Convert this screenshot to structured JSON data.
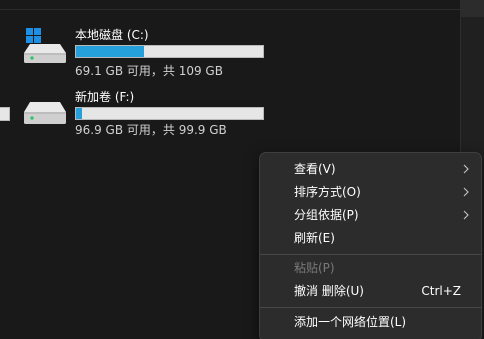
{
  "drives": [
    {
      "name": "本地磁盘 (C:)",
      "info": "69.1 GB 可用，共 109 GB",
      "used_fraction": 0.366,
      "icon": "windows-drive-icon"
    },
    {
      "name": "新加卷 (F:)",
      "info": "96.9 GB 可用，共 99.9 GB",
      "used_fraction": 0.03,
      "icon": "hard-drive-icon"
    }
  ],
  "colors": {
    "background": "#191919",
    "bar_fill": "#26a0da",
    "bar_track": "#e6e6e6",
    "menu_bg": "#2c2c2c",
    "menu_disabled_text": "#7a7a7a"
  },
  "context_menu": {
    "items": [
      {
        "label": "查看(V)",
        "submenu": true
      },
      {
        "label": "排序方式(O)",
        "submenu": true
      },
      {
        "label": "分组依据(P)",
        "submenu": true
      },
      {
        "label": "刷新(E)"
      },
      {
        "label": "粘贴(P)",
        "disabled": true
      },
      {
        "label": "撤消 删除(U)",
        "shortcut": "Ctrl+Z"
      },
      {
        "label": "添加一个网络位置(L)"
      }
    ]
  }
}
